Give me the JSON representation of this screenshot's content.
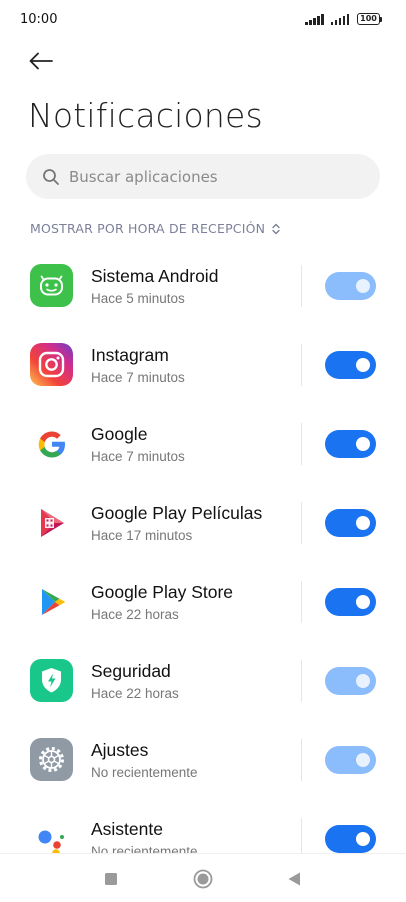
{
  "status_bar": {
    "time": "10:00",
    "battery": "100"
  },
  "header": {
    "back_icon": "arrow-left-icon",
    "title": "Notificaciones"
  },
  "search": {
    "icon": "search-icon",
    "placeholder": "Buscar aplicaciones"
  },
  "sort": {
    "label": "MOSTRAR POR HORA DE RECEPCIÓN",
    "icon": "chevron-up-down-icon"
  },
  "apps": [
    {
      "name": "Sistema Android",
      "time": "Hace 5 minutos",
      "icon": "android-icon",
      "enabled": true,
      "toggle_disabled": true
    },
    {
      "name": "Instagram",
      "time": "Hace 7 minutos",
      "icon": "instagram-icon",
      "enabled": true,
      "toggle_disabled": false
    },
    {
      "name": "Google",
      "time": "Hace 7 minutos",
      "icon": "google-icon",
      "enabled": true,
      "toggle_disabled": false
    },
    {
      "name": "Google Play Películas",
      "time": "Hace 17 minutos",
      "icon": "play-movies-icon",
      "enabled": true,
      "toggle_disabled": false
    },
    {
      "name": "Google Play Store",
      "time": "Hace 22 horas",
      "icon": "play-store-icon",
      "enabled": true,
      "toggle_disabled": false
    },
    {
      "name": "Seguridad",
      "time": "Hace 22 horas",
      "icon": "security-shield-icon",
      "enabled": true,
      "toggle_disabled": true
    },
    {
      "name": "Ajustes",
      "time": "No recientemente",
      "icon": "settings-gear-icon",
      "enabled": true,
      "toggle_disabled": true
    },
    {
      "name": "Asistente",
      "time": "No recientemente",
      "icon": "assistant-icon",
      "enabled": true,
      "toggle_disabled": false
    }
  ],
  "colors": {
    "toggle_on": "#1a73f0",
    "toggle_on_disabled": "#8bbcfb",
    "android_green": "#3ec14a",
    "security_green": "#19c78a"
  },
  "nav_bar": {
    "recents_icon": "square-recents-icon",
    "home_icon": "circle-home-icon",
    "back_icon": "triangle-back-icon"
  }
}
